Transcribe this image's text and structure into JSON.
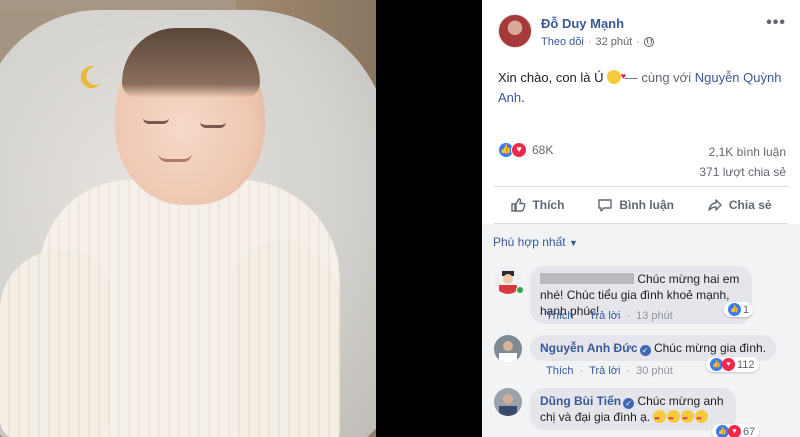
{
  "post": {
    "author": "Đỗ Duy Mạnh",
    "follow": "Theo dõi",
    "time": "32 phút",
    "text_main": "Xin chào, con là Ú",
    "text_with": "— cùng với",
    "tagged": "Nguyễn Quỳnh Anh",
    "text_end": ".",
    "reaction_count": "68K",
    "comments_count": "2,1K bình luận",
    "shares_count": "371 lượt chia sẻ"
  },
  "actions": {
    "like": "Thích",
    "comment": "Bình luận",
    "share": "Chia sẻ"
  },
  "sort_label": "Phù hợp nhất",
  "comments": [
    {
      "name": "",
      "text_line1": "Chúc mừng hai em nhé! Chúc",
      "text_line2": "tiểu gia đình khoẻ mạnh, hạnh phúc!",
      "like": "Thích",
      "reply": "Trả lời",
      "time": "13 phút",
      "reactions": "1"
    },
    {
      "name": "Nguyễn Anh Đức",
      "text_line1": "Chúc mừng gia đình.",
      "like": "Thích",
      "reply": "Trả lời",
      "time": "30 phút",
      "reactions": "112"
    },
    {
      "name": "Dũng Bùi Tiến",
      "text_line1": "Chúc mừng anh chị và",
      "text_line2": "đại gia đình ạ.",
      "reactions": "67"
    }
  ],
  "icons": {
    "more": "more-icon",
    "globe": "globe-icon",
    "like": "thumbs-up-icon",
    "comment": "comment-icon",
    "share": "share-icon"
  },
  "colors": {
    "link": "#385898",
    "like": "#3b7cf5",
    "love": "#f0284a",
    "comment_bg": "#f2f3f5"
  }
}
